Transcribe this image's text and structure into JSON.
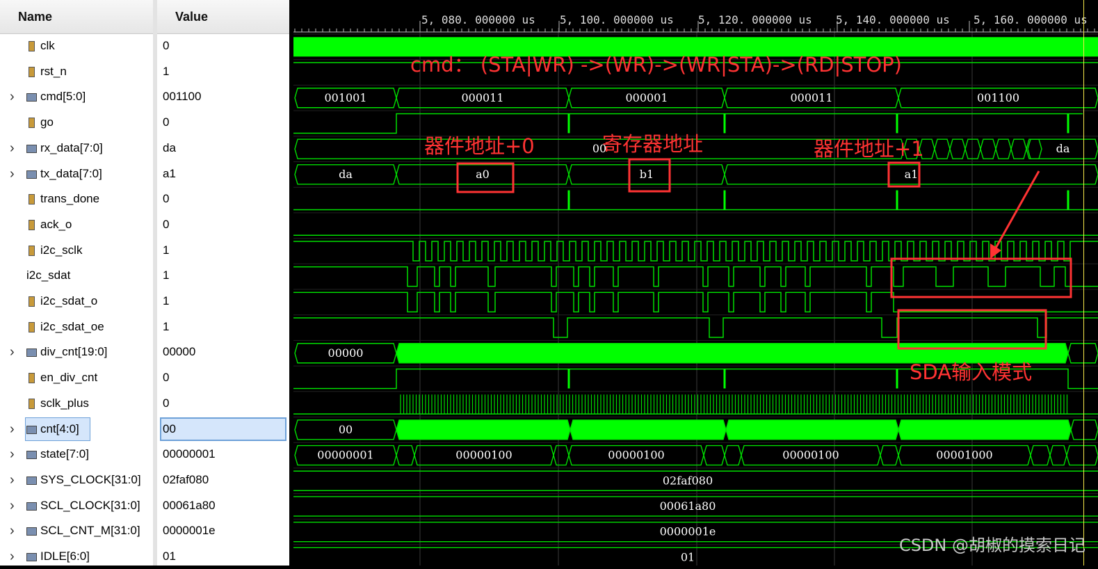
{
  "headers": {
    "name": "Name",
    "value": "Value"
  },
  "signals": [
    {
      "name": "clk",
      "value": "0",
      "icon": "bit-signal-icon",
      "expandable": false
    },
    {
      "name": "rst_n",
      "value": "1",
      "icon": "bit-signal-icon",
      "expandable": false
    },
    {
      "name": "cmd[5:0]",
      "value": "001100",
      "icon": "bus-signal-icon",
      "expandable": true
    },
    {
      "name": "go",
      "value": "0",
      "icon": "bit-signal-icon",
      "expandable": false
    },
    {
      "name": "rx_data[7:0]",
      "value": "da",
      "icon": "bus-signal-icon",
      "expandable": true
    },
    {
      "name": "tx_data[7:0]",
      "value": "a1",
      "icon": "bus-signal-icon",
      "expandable": true
    },
    {
      "name": "trans_done",
      "value": "0",
      "icon": "bit-signal-icon",
      "expandable": false
    },
    {
      "name": "ack_o",
      "value": "0",
      "icon": "bit-signal-icon",
      "expandable": false
    },
    {
      "name": "i2c_sclk",
      "value": "1",
      "icon": "bit-signal-icon",
      "expandable": false
    },
    {
      "name": "i2c_sdat",
      "value": "1",
      "icon": "none",
      "expandable": false
    },
    {
      "name": "i2c_sdat_o",
      "value": "1",
      "icon": "bit-signal-icon",
      "expandable": false
    },
    {
      "name": "i2c_sdat_oe",
      "value": "1",
      "icon": "bit-signal-icon",
      "expandable": false
    },
    {
      "name": "div_cnt[19:0]",
      "value": "00000",
      "icon": "bus-signal-icon",
      "expandable": true
    },
    {
      "name": "en_div_cnt",
      "value": "0",
      "icon": "bit-signal-icon",
      "expandable": false
    },
    {
      "name": "sclk_plus",
      "value": "0",
      "icon": "bit-signal-icon",
      "expandable": false
    },
    {
      "name": "cnt[4:0]",
      "value": "00",
      "icon": "bus-signal-icon",
      "expandable": true,
      "selected": true
    },
    {
      "name": "state[7:0]",
      "value": "00000001",
      "icon": "bus-signal-icon",
      "expandable": true
    },
    {
      "name": "SYS_CLOCK[31:0]",
      "value": "02faf080",
      "icon": "bus-signal-icon",
      "expandable": true
    },
    {
      "name": "SCL_CLOCK[31:0]",
      "value": "00061a80",
      "icon": "bus-signal-icon",
      "expandable": true
    },
    {
      "name": "SCL_CNT_M[31:0]",
      "value": "0000001e",
      "icon": "bus-signal-icon",
      "expandable": true
    },
    {
      "name": "IDLE[6:0]",
      "value": "01",
      "icon": "bus-signal-icon",
      "expandable": true
    }
  ],
  "timeline": {
    "labels": [
      "5, 080. 000000  us",
      "5, 100. 000000  us",
      "5, 120. 000000  us",
      "5, 140. 000000  us",
      "5, 160. 000000  us"
    ],
    "times_us": [
      5080,
      5100,
      5120,
      5140,
      5160
    ]
  },
  "bus_labels": {
    "cmd": [
      "001001",
      "000011",
      "000001",
      "000011",
      "001100"
    ],
    "rx_data": [
      "00",
      "da"
    ],
    "tx_data": [
      "da",
      "a0",
      "b1",
      "a1"
    ],
    "div_cnt": [
      "00000"
    ],
    "cnt": [
      "00"
    ],
    "state": [
      "00000001",
      "00000100",
      "00000100",
      "00000100",
      "00001000"
    ],
    "sys_clock": "02faf080",
    "scl_clock": "00061a80",
    "scl_cnt_m": "0000001e",
    "idle": "01"
  },
  "annotations": {
    "cmd_note": "cmd：  (STA|WR)  ->(WR)->(WR|STA)->(RD|STOP)",
    "dev_addr_0": "器件地址+0",
    "reg_addr": "寄存器地址",
    "dev_addr_1": "器件地址+1",
    "sda_input": "SDA输入模式"
  },
  "watermark": "CSDN @胡椒的摸索日记",
  "colors": {
    "wave": "#00e000",
    "wave_fill": "#00ff00",
    "annotation": "#ff3333",
    "cursor": "#f6e84a",
    "grid": "#2f2f2f",
    "selection": "#d5e6fb"
  }
}
